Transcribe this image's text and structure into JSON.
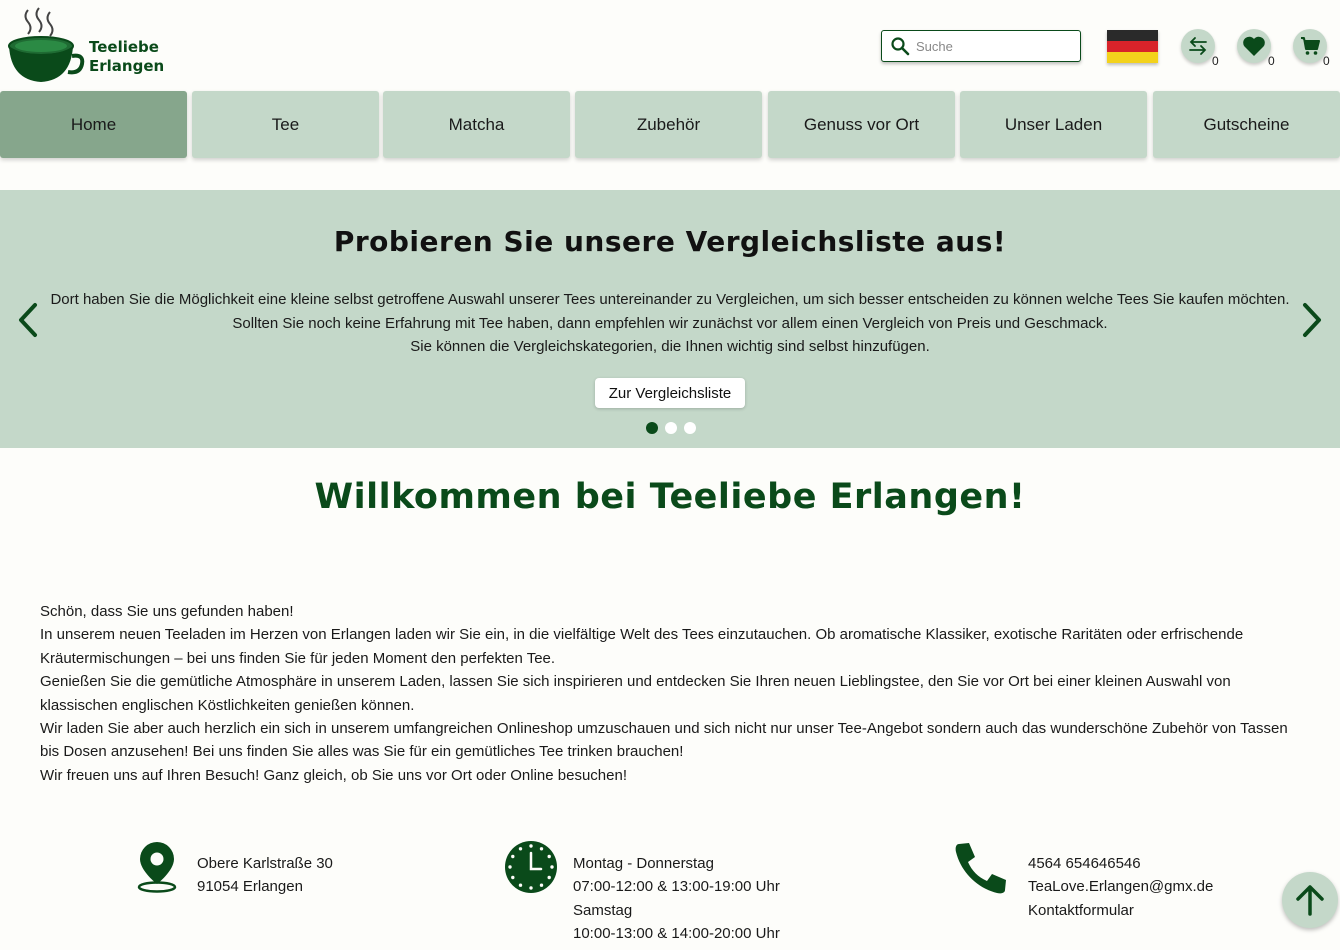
{
  "brand": {
    "name_line1": "Teeliebe",
    "name_line2": "Erlangen"
  },
  "search": {
    "placeholder": "Suche"
  },
  "header": {
    "language_flag": "de-flag-icon",
    "compare_count": "0",
    "wishlist_count": "0",
    "cart_count": "0"
  },
  "nav": [
    {
      "label": "Home",
      "active": true
    },
    {
      "label": "Tee"
    },
    {
      "label": "Matcha"
    },
    {
      "label": "Zubehör"
    },
    {
      "label": "Genuss vor Ort"
    },
    {
      "label": "Unser Laden"
    },
    {
      "label": "Gutscheine"
    }
  ],
  "hero": {
    "title": "Probieren Sie unsere Vergleichsliste aus!",
    "lines": [
      "Dort haben Sie die Möglichkeit eine kleine selbst getroffene Auswahl unserer Tees untereinander zu Vergleichen, um sich besser entscheiden zu können welche Tees Sie kaufen möchten.",
      "Sollten Sie noch keine Erfahrung mit Tee haben, dann empfehlen wir zunächst vor allem einen Vergleich von Preis und Geschmack.",
      "Sie können die Vergleichskategorien, die Ihnen wichtig sind selbst hinzufügen."
    ],
    "button_label": "Zur Vergleichsliste",
    "slide_count": 3,
    "active_slide": 1
  },
  "welcome": {
    "title": "Willkommen bei Teeliebe Erlangen!",
    "paragraphs": [
      "Schön, dass Sie uns gefunden haben!",
      "In unserem neuen Teeladen im Herzen von Erlangen laden wir Sie ein, in die vielfältige Welt des Tees einzutauchen. Ob aromatische Klassiker, exotische Raritäten oder erfrischende Kräutermischungen – bei uns finden Sie für jeden Moment den perfekten Tee.",
      "Genießen Sie die gemütliche Atmosphäre in unserem Laden, lassen Sie sich inspirieren und entdecken Sie Ihren neuen Lieblingstee, den Sie vor Ort bei einer kleinen Auswahl von klassischen englischen Köstlichkeiten genießen können.",
      "Wir laden Sie aber auch herzlich ein sich in unserem umfangreichen Onlineshop umzuschauen und sich nicht nur unser Tee-Angebot sondern auch das wunderschöne Zubehör von Tassen bis Dosen anzusehen! Bei uns finden Sie alles was Sie für ein gemütliches Tee trinken brauchen!",
      "Wir freuen uns auf Ihren Besuch! Ganz gleich, ob Sie uns vor Ort oder Online besuchen!"
    ]
  },
  "address": {
    "street": "Obere Karlstraße 30",
    "city": "91054 Erlangen"
  },
  "hours": {
    "days1": "Montag - Donnerstag",
    "times1": "07:00-12:00 & 13:00-19:00 Uhr",
    "days2": "Samstag",
    "times2": "10:00-13:00 & 14:00-20:00 Uhr"
  },
  "contact": {
    "phone": "4564 654646546",
    "email": "TeaLove.Erlangen@gmx.de",
    "form_link": "Kontaktformular"
  },
  "colors": {
    "brand_green": "#0a4a1a",
    "light_green": "#c4d8c9",
    "active_tab": "#86a68c",
    "background": "#fdfdfa"
  }
}
